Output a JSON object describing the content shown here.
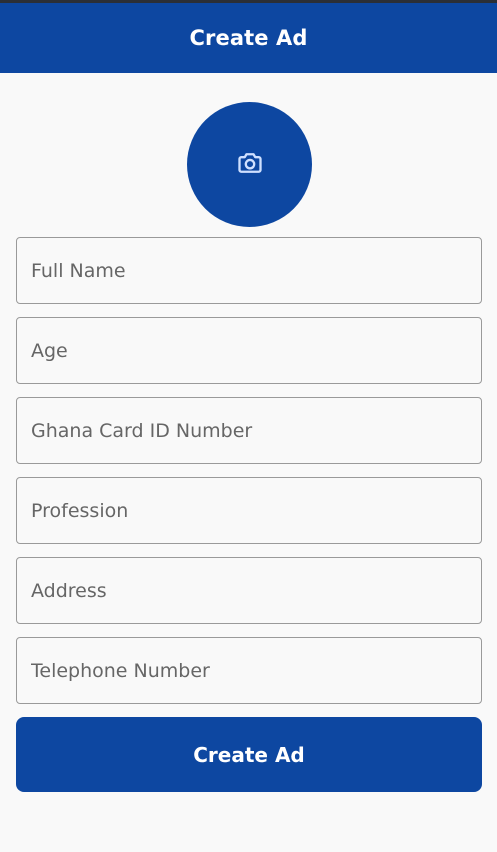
{
  "app_bar": {
    "title": "Create Ad"
  },
  "photo": {
    "icon": "camera-icon"
  },
  "form": {
    "fields": [
      {
        "name": "full-name-field",
        "placeholder": "Full Name"
      },
      {
        "name": "age-field",
        "placeholder": "Age"
      },
      {
        "name": "ghana-card-id-field",
        "placeholder": "Ghana Card ID Number"
      },
      {
        "name": "profession-field",
        "placeholder": "Profession"
      },
      {
        "name": "address-field",
        "placeholder": "Address"
      },
      {
        "name": "telephone-field",
        "placeholder": "Telephone Number"
      }
    ],
    "submit_label": "Create Ad"
  },
  "colors": {
    "primary": "#0d47a1",
    "background": "#f9f9f9",
    "icon": "#cfe0ff"
  }
}
